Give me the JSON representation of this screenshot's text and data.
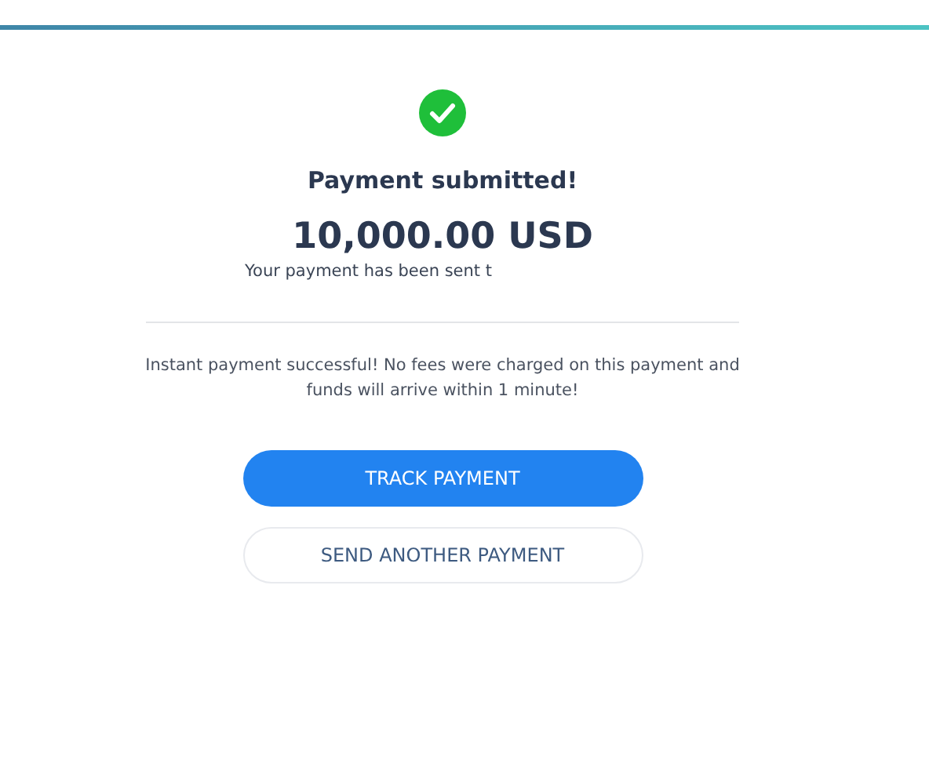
{
  "title": "Payment submitted!",
  "amount": "10,000.00 USD",
  "sent_note": "Your payment has been sent t",
  "message": "Instant payment successful! No fees were charged on this payment and funds will arrive within 1 minute!",
  "buttons": [
    {
      "label": "TRACK PAYMENT",
      "kind": "primary"
    },
    {
      "label": "SEND ANOTHER PAYMENT",
      "kind": "secondary"
    }
  ]
}
